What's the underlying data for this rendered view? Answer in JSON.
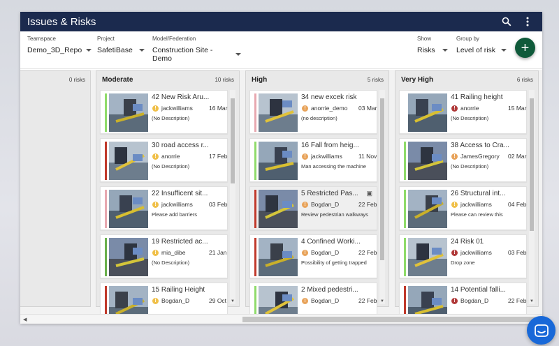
{
  "app": {
    "title": "Issues & Risks"
  },
  "filters": {
    "teamspace": {
      "label": "Teamspace",
      "value": "Demo_3D_Repo"
    },
    "project": {
      "label": "Project",
      "value": "SafetiBase"
    },
    "model": {
      "label": "Model/Federation",
      "value": "Construction Site - Demo"
    },
    "show": {
      "label": "Show",
      "value": "Risks"
    },
    "group_by": {
      "label": "Group by",
      "value": "Level of risk"
    }
  },
  "colors": {
    "header": "#1b2a4e",
    "fab": "#0f5a3a",
    "chat": "#1868d8",
    "owner_warning": "#f0c04a",
    "owner_high": "#e8a35a",
    "owner_critical": "#b03a3a",
    "stripe_low": "#8fdb6a",
    "stripe_medium": "#6ab04c",
    "stripe_high": "#c0392b",
    "stripe_pink": "#e7a8b0"
  },
  "columns": [
    {
      "title": "",
      "count": "0 risks",
      "cards": []
    },
    {
      "title": "Moderate",
      "count": "10 risks",
      "cards": [
        {
          "title": "42 New Risk Aru...",
          "owner": "jackwilliams",
          "date": "16 Mar",
          "desc": "(No Description)",
          "stripe": "#8fdb6a",
          "owner_icon": "warning-icon",
          "owner_color": "#f0c04a"
        },
        {
          "title": "30 road access r...",
          "owner": "anorrie",
          "date": "17 Feb",
          "desc": "(No Description)",
          "stripe": "#c0392b",
          "owner_icon": "warning-icon",
          "owner_color": "#f0c04a"
        },
        {
          "title": "22 Insufficent sit...",
          "owner": "jackwilliams",
          "date": "03 Feb",
          "desc": "Please add barriers",
          "stripe": "#e7a8b0",
          "owner_icon": "warning-icon",
          "owner_color": "#f0c04a"
        },
        {
          "title": "19 Restricted ac...",
          "owner": "mia_dibe",
          "date": "21 Jan",
          "desc": "(No Description)",
          "stripe": "#6ab04c",
          "owner_icon": "warning-icon",
          "owner_color": "#f0c04a"
        },
        {
          "title": "15 Railing Height",
          "owner": "Bogdan_D",
          "date": "29 Oct",
          "desc": "",
          "stripe": "#c0392b",
          "owner_icon": "warning-icon",
          "owner_color": "#f0c04a"
        }
      ]
    },
    {
      "title": "High",
      "count": "5 risks",
      "cards": [
        {
          "title": "34 new excek risk",
          "owner": "anorrie_demo",
          "date": "03 Mar",
          "desc": "(no description)",
          "stripe": "#e7a8b0",
          "owner_icon": "warning-icon",
          "owner_color": "#e8a35a"
        },
        {
          "title": "16 Fall from heig...",
          "owner": "jackwilliams",
          "date": "11 Nov",
          "desc": "Man accessing the machine",
          "stripe": "#8fdb6a",
          "owner_icon": "warning-icon",
          "owner_color": "#e8a35a"
        },
        {
          "title": "5 Restricted Pas...",
          "owner": "Bogdan_D",
          "date": "22 Feb",
          "desc": "Review pedestrian walkways",
          "stripe": "#c0392b",
          "owner_icon": "warning-icon",
          "owner_color": "#e8a35a",
          "selected": true
        },
        {
          "title": "4 Confined Worki...",
          "owner": "Bogdan_D",
          "date": "22 Feb",
          "desc": "Possibility of getting trapped",
          "stripe": "#c0392b",
          "owner_icon": "warning-icon",
          "owner_color": "#e8a35a"
        },
        {
          "title": "2 Mixed pedestri...",
          "owner": "Bogdan_D",
          "date": "22 Feb",
          "desc": "",
          "stripe": "#8fdb6a",
          "owner_icon": "warning-icon",
          "owner_color": "#e8a35a"
        }
      ]
    },
    {
      "title": "Very High",
      "count": "6 risks",
      "cards": [
        {
          "title": "41 Railing height",
          "owner": "anorrie",
          "date": "15 Mar",
          "desc": "(No Description)",
          "stripe": "#ffffff",
          "owner_icon": "alert-icon",
          "owner_color": "#b03a3a"
        },
        {
          "title": "38 Access to Cra...",
          "owner": "JamesGregory",
          "date": "02 Mar",
          "desc": "(No Description)",
          "stripe": "#8fdb6a",
          "owner_icon": "warning-icon",
          "owner_color": "#e8a35a"
        },
        {
          "title": "26 Structural int...",
          "owner": "jackwilliams",
          "date": "04 Feb",
          "desc": "Please can review this",
          "stripe": "#8fdb6a",
          "owner_icon": "warning-icon",
          "owner_color": "#f0c04a"
        },
        {
          "title": "24 Risk 01",
          "owner": "jackwilliams",
          "date": "03 Feb",
          "desc": "Drop zone",
          "stripe": "#8fdb6a",
          "owner_icon": "alert-icon",
          "owner_color": "#b03a3a"
        },
        {
          "title": "14 Potential falli...",
          "owner": "Bogdan_D",
          "date": "22 Feb",
          "desc": "",
          "stripe": "#c0392b",
          "owner_icon": "alert-icon",
          "owner_color": "#b03a3a"
        }
      ]
    }
  ]
}
